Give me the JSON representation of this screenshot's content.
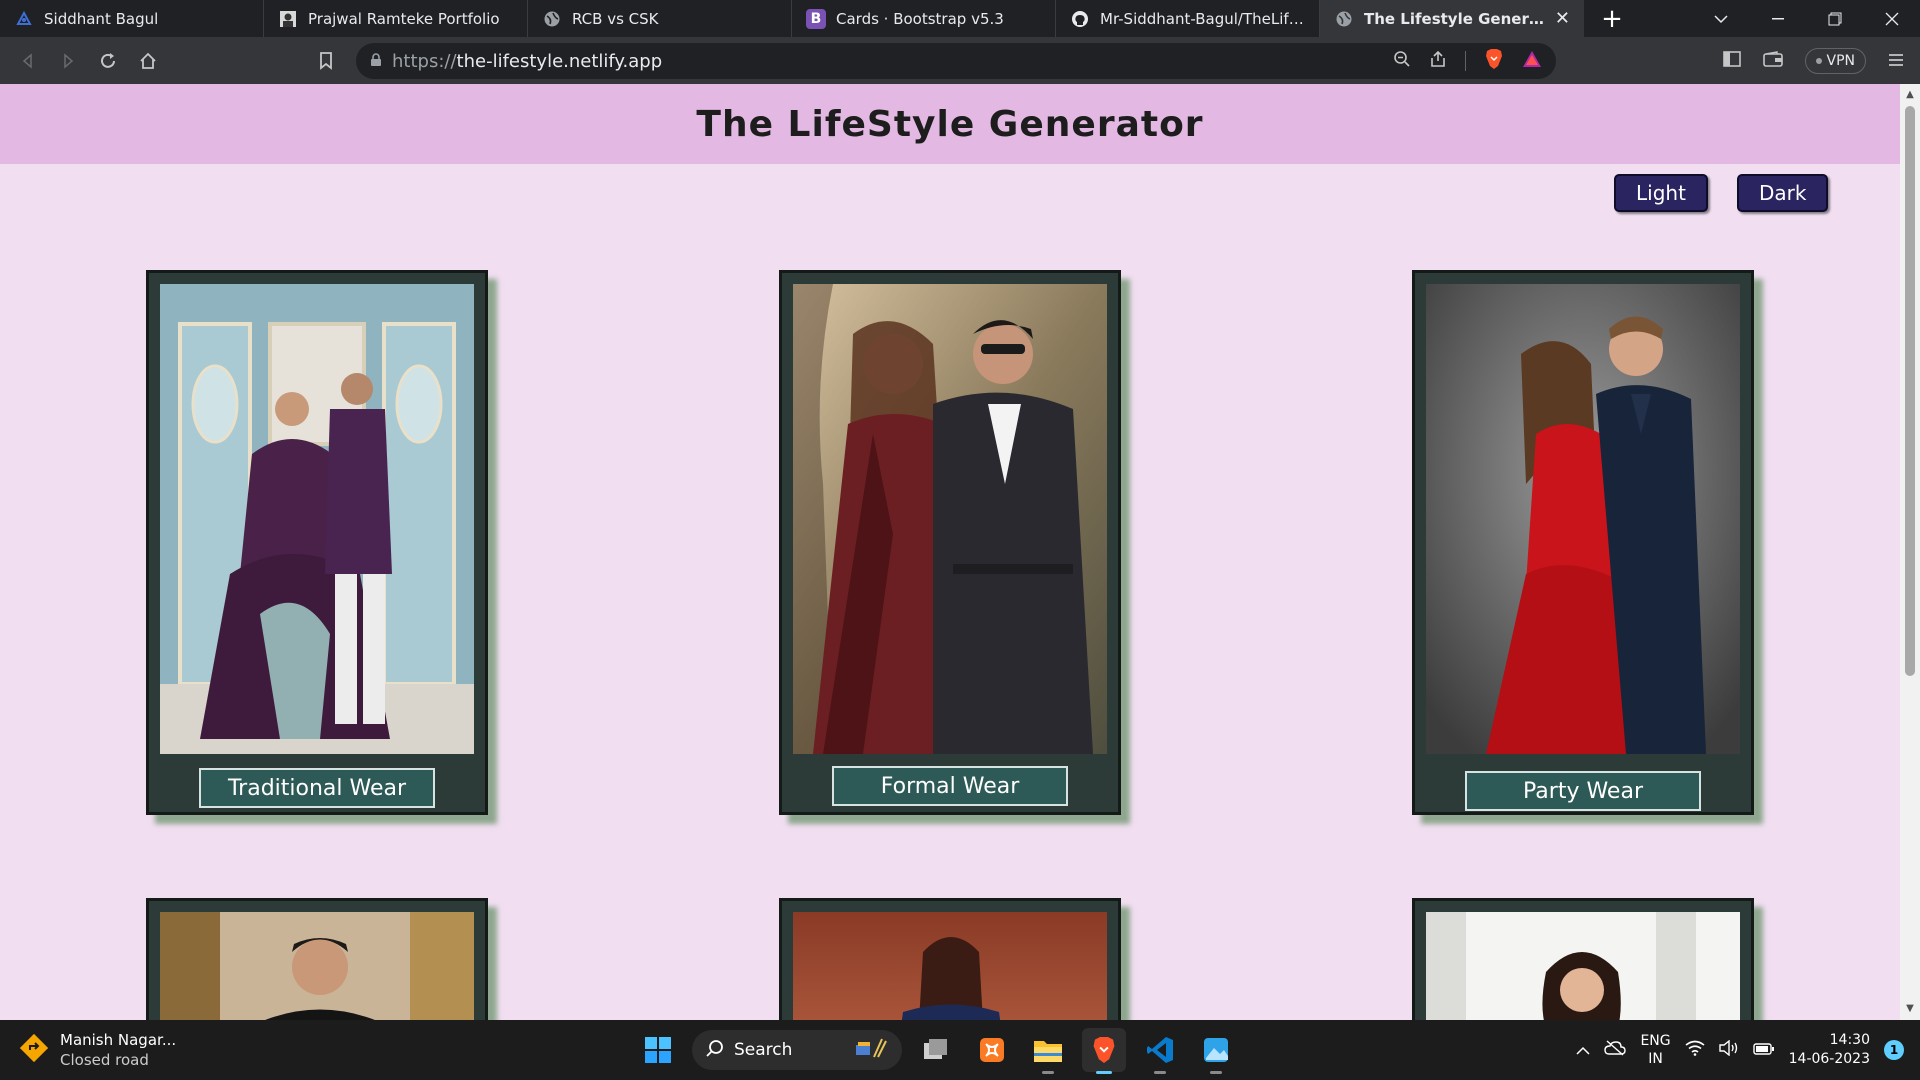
{
  "browser": {
    "tabs": [
      {
        "title": "Siddhant Bagul",
        "icon": "siddhant-logo-icon"
      },
      {
        "title": "Prajwal Ramteke Portfolio",
        "icon": "portfolio-avatar-icon"
      },
      {
        "title": "RCB vs CSK",
        "icon": "globe-icon"
      },
      {
        "title": "Cards · Bootstrap v5.3",
        "icon": "bootstrap-icon"
      },
      {
        "title": "Mr-Siddhant-Bagul/TheLifestyle",
        "icon": "github-icon"
      },
      {
        "title": "The Lifestyle Generator",
        "icon": "globe-icon"
      }
    ],
    "url_prefix": "https://",
    "url_host": "the-lifestyle.netlify.app",
    "vpn_label": "VPN",
    "bootstrap_letter": "B"
  },
  "page": {
    "title": "The LifeStyle Generator",
    "light_label": "Light",
    "dark_label": "Dark",
    "cards": [
      {
        "label": "Traditional Wear"
      },
      {
        "label": "Formal Wear"
      },
      {
        "label": "Party Wear"
      }
    ]
  },
  "taskbar": {
    "weather_title": "Manish Nagar...",
    "weather_sub": "Closed road",
    "search_label": "Search",
    "lang_top": "ENG",
    "lang_bottom": "IN",
    "time": "14:30",
    "date": "14-06-2023",
    "notification_count": "1"
  },
  "colors": {
    "page_bg": "#f1dff1",
    "header_bg": "#e3b9e3",
    "button_bg": "#2a2460",
    "card_bg": "#2c3b38",
    "label_bg": "#2d5a56"
  }
}
